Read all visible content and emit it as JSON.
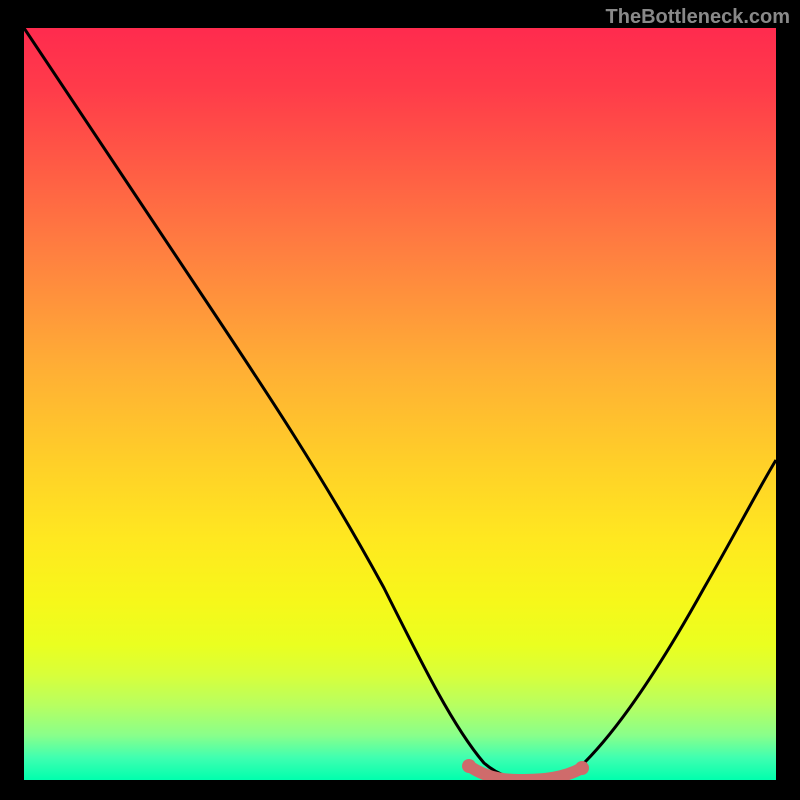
{
  "watermark": "TheBottleneck.com",
  "chart_data": {
    "type": "line",
    "title": "",
    "xlabel": "",
    "ylabel": "",
    "xlim": [
      0,
      100
    ],
    "ylim": [
      0,
      100
    ],
    "series": [
      {
        "name": "bottleneck-curve",
        "x": [
          0,
          10,
          20,
          30,
          40,
          50,
          58,
          62,
          68,
          72,
          78,
          85,
          92,
          100
        ],
        "y": [
          100,
          85,
          70,
          55,
          40,
          25,
          10,
          3,
          0,
          0,
          3,
          12,
          25,
          42
        ]
      }
    ],
    "markers": {
      "name": "highlight-segment",
      "color": "#d46a6a",
      "x": [
        58,
        62,
        66,
        70,
        74
      ],
      "y": [
        3,
        1,
        0,
        0,
        2
      ]
    },
    "gradient_stops": [
      {
        "pos": 0,
        "color": "#ff2b4e"
      },
      {
        "pos": 50,
        "color": "#ffd028"
      },
      {
        "pos": 80,
        "color": "#f7f71a"
      },
      {
        "pos": 100,
        "color": "#00ffae"
      }
    ]
  }
}
